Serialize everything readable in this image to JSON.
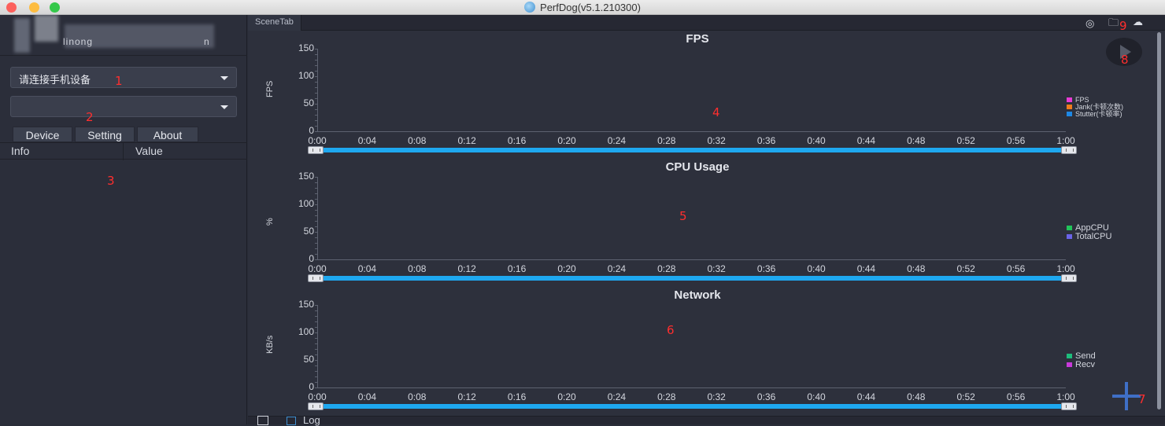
{
  "window": {
    "title": "PerfDog(v5.1.210300)",
    "traffic_lights": {
      "close": "#fc605c",
      "minimize": "#fdbc40",
      "maximize": "#34c84a"
    }
  },
  "sidebar": {
    "account_fragments": [
      "linong",
      "n"
    ],
    "device_select": {
      "value": "请连接手机设备"
    },
    "app_select": {
      "value": ""
    },
    "tabs": [
      {
        "label": "Device"
      },
      {
        "label": "Setting"
      },
      {
        "label": "About"
      }
    ],
    "table": {
      "col_info": "Info",
      "col_value": "Value"
    }
  },
  "main": {
    "scene_tab": "SceneTab",
    "toolbar_icons": [
      "location-icon",
      "folder-icon",
      "cloud-icon"
    ],
    "bottom_log": "Log"
  },
  "markers": [
    "1",
    "2",
    "3",
    "4",
    "5",
    "6",
    "7",
    "8",
    "9"
  ],
  "colors": {
    "accent_slider": "#1ea8f0",
    "fps": "#e83ad4",
    "jank": "#f07c1c",
    "stutter": "#1e88e5",
    "appcpu": "#21c45a",
    "totalcpu": "#6a64e8",
    "send": "#1ebd7c",
    "recv": "#c83adb",
    "marker": "#ff2e2e"
  },
  "chart_data": [
    {
      "type": "line",
      "title": "FPS",
      "ylabel": "FPS",
      "ylim": [
        0,
        150
      ],
      "yticks": [
        "0",
        "50",
        "100",
        "150"
      ],
      "x": [
        "0:00",
        "0:04",
        "0:08",
        "0:12",
        "0:16",
        "0:20",
        "0:24",
        "0:28",
        "0:32",
        "0:36",
        "0:40",
        "0:44",
        "0:48",
        "0:52",
        "0:56",
        "1:00"
      ],
      "legend_position": "right",
      "series": [
        {
          "name": "FPS",
          "values": []
        },
        {
          "name": "Jank(卡顿次数)",
          "values": []
        },
        {
          "name": "Stutter(卡顿率)",
          "values": []
        }
      ]
    },
    {
      "type": "line",
      "title": "CPU Usage",
      "ylabel": "%",
      "ylim": [
        0,
        150
      ],
      "yticks": [
        "0",
        "50",
        "100",
        "150"
      ],
      "x": [
        "0:00",
        "0:04",
        "0:08",
        "0:12",
        "0:16",
        "0:20",
        "0:24",
        "0:28",
        "0:32",
        "0:36",
        "0:40",
        "0:44",
        "0:48",
        "0:52",
        "0:56",
        "1:00"
      ],
      "legend_position": "right",
      "series": [
        {
          "name": "AppCPU",
          "values": []
        },
        {
          "name": "TotalCPU",
          "values": []
        }
      ]
    },
    {
      "type": "line",
      "title": "Network",
      "ylabel": "KB/s",
      "ylim": [
        0,
        150
      ],
      "yticks": [
        "0",
        "50",
        "100",
        "150"
      ],
      "x": [
        "0:00",
        "0:04",
        "0:08",
        "0:12",
        "0:16",
        "0:20",
        "0:24",
        "0:28",
        "0:32",
        "0:36",
        "0:40",
        "0:44",
        "0:48",
        "0:52",
        "0:56",
        "1:00"
      ],
      "legend_position": "right",
      "series": [
        {
          "name": "Send",
          "values": []
        },
        {
          "name": "Recv",
          "values": []
        }
      ]
    }
  ]
}
